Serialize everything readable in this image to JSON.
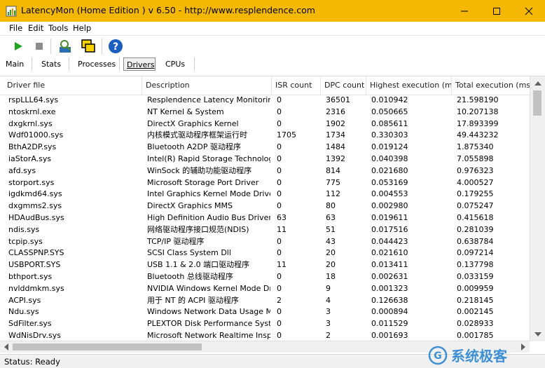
{
  "window": {
    "title": "LatencyMon  (Home Edition )  v 6.50 - http://www.resplendence.com",
    "accent_color": "#f5b800",
    "controls": [
      "minimize-icon",
      "maximize-icon",
      "close-icon"
    ]
  },
  "menu": {
    "items": [
      "File",
      "Edit",
      "Tools",
      "Help"
    ]
  },
  "toolbar": {
    "buttons": [
      "play-icon",
      "stop-icon",
      "analyze-icon",
      "window-icon",
      "help-icon"
    ]
  },
  "tabs": {
    "items": [
      "Main",
      "Stats",
      "Processes",
      "Drivers",
      "CPUs"
    ],
    "active": "Drivers"
  },
  "table": {
    "columns": [
      "Driver file",
      "Description",
      "ISR count",
      "DPC count",
      "Highest execution (ms)",
      "Total execution (ms)"
    ],
    "rows": [
      [
        "rspLLL64.sys",
        "Resplendence Latency Monitorin...",
        "0",
        "36501",
        "0.010942",
        "21.598190"
      ],
      [
        "ntoskrnl.exe",
        "NT Kernel & System",
        "0",
        "2316",
        "0.050665",
        "10.207138"
      ],
      [
        "dxgkrnl.sys",
        "DirectX Graphics Kernel",
        "0",
        "1902",
        "0.085611",
        "17.893399"
      ],
      [
        "Wdf01000.sys",
        "内核模式驱动程序框架运行时",
        "1705",
        "1734",
        "0.330303",
        "49.443232"
      ],
      [
        "BthA2DP.sys",
        "Bluetooth A2DP 驱动程序",
        "0",
        "1484",
        "0.019124",
        "1.875340"
      ],
      [
        "iaStorA.sys",
        "Intel(R) Rapid Storage Technolog...",
        "0",
        "1392",
        "0.040398",
        "7.055898"
      ],
      [
        "afd.sys",
        "WinSock 的辅助功能驱动程序",
        "0",
        "814",
        "0.021680",
        "0.976323"
      ],
      [
        "storport.sys",
        "Microsoft Storage Port Driver",
        "0",
        "775",
        "0.053169",
        "4.000527"
      ],
      [
        "igdkmd64.sys",
        "Intel Graphics Kernel Mode Driver",
        "0",
        "112",
        "0.004553",
        "0.179255"
      ],
      [
        "dxgmms2.sys",
        "DirectX Graphics MMS",
        "0",
        "80",
        "0.002980",
        "0.075247"
      ],
      [
        "HDAudBus.sys",
        "High Definition Audio Bus Driver",
        "63",
        "63",
        "0.019611",
        "0.415618"
      ],
      [
        "ndis.sys",
        "网络驱动程序接口规范(NDIS)",
        "11",
        "51",
        "0.017516",
        "0.281039"
      ],
      [
        "tcpip.sys",
        "TCP/IP 驱动程序",
        "0",
        "43",
        "0.044423",
        "0.638784"
      ],
      [
        "CLASSPNP.SYS",
        "SCSI Class System Dll",
        "0",
        "20",
        "0.021610",
        "0.097214"
      ],
      [
        "USBPORT.SYS",
        "USB 1.1 & 2.0 端口驱动程序",
        "11",
        "20",
        "0.013411",
        "0.137798"
      ],
      [
        "bthport.sys",
        "Bluetooth 总线驱动程序",
        "0",
        "18",
        "0.002631",
        "0.033159"
      ],
      [
        "nvlddmkm.sys",
        "NVIDIA Windows Kernel Mode Dri...",
        "0",
        "9",
        "0.001323",
        "0.009959"
      ],
      [
        "ACPI.sys",
        "用于 NT 的 ACPI 驱动程序",
        "2",
        "4",
        "0.126638",
        "0.218145"
      ],
      [
        "Ndu.sys",
        "Windows Network Data Usage M...",
        "0",
        "3",
        "0.000894",
        "0.002145"
      ],
      [
        "SdFilter.sys",
        "PLEXTOR Disk Performance System",
        "0",
        "3",
        "0.011529",
        "0.028933"
      ],
      [
        "WdNisDrv.sys",
        "Microsoft Network Realtime Insp...",
        "0",
        "2",
        "0.001693",
        "0.001785"
      ]
    ]
  },
  "status": {
    "text": "Status: Ready"
  },
  "watermark": {
    "text": "系统极客"
  }
}
